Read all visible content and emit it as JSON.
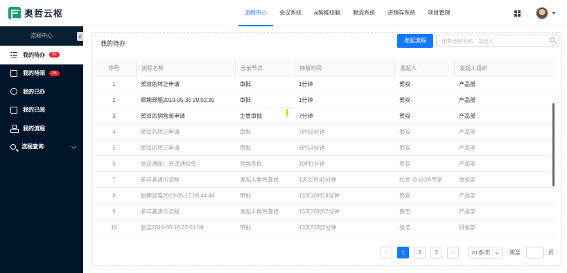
{
  "brand": {
    "name": "奥哲云枢"
  },
  "nav": [
    "流程中心",
    "会议系统",
    "ai智能纺聊",
    "物流系统",
    "进销存系统",
    "项目管理"
  ],
  "sidebar": {
    "title": "流程中心",
    "items": [
      {
        "label": "我的待办",
        "badge": "58"
      },
      {
        "label": "我的待阅",
        "badge": "35"
      },
      {
        "label": "我的已办"
      },
      {
        "label": "我的已阅"
      },
      {
        "label": "我的流程"
      },
      {
        "label": "流程查询"
      }
    ]
  },
  "main": {
    "title": "我的待办",
    "start_button": "发起流程",
    "search_placeholder": "搜索流程名称、发起人"
  },
  "table": {
    "columns": [
      "序号",
      "流程名称",
      "当前节点",
      "停留时间",
      "发起人",
      "发起人组织"
    ],
    "rows": [
      [
        "1",
        "贺双的转正申请",
        "审批",
        "1分钟",
        "贺双",
        "产品部"
      ],
      [
        "2",
        "佩鲍邸辊2019-05-30 20:02:20",
        "审批",
        "1分钟",
        "贺双",
        "产品部"
      ],
      [
        "3",
        "贺双的销售单申请",
        "主管审批",
        "7分钟",
        "贺双",
        "产品部"
      ],
      [
        "4",
        "贺双的转正申请",
        "审批",
        "7时55分钟",
        "贺双",
        "产品部"
      ],
      [
        "5",
        "贺双的转正申请",
        "审批",
        "8时14分钟",
        "贺双",
        "产品部"
      ],
      [
        "6",
        "会议通知：会议通知单",
        "领导签批",
        "10时1分钟",
        "贺双",
        "产品部"
      ],
      [
        "7",
        "参与者演示流程",
        "发起人角色查找",
        "1天20时41分钟",
        "纪龙-办公OA专家",
        "体验部"
      ],
      [
        "8",
        "佩鲍邸辊2019-05-17 09:44:44",
        "审批",
        "13天10时19分钟",
        "贺双",
        "产品部"
      ],
      [
        "9",
        "参与者演示流程",
        "发起人角色查找",
        "13天20时57分钟",
        "黄杰",
        "产品部"
      ],
      [
        "10",
        "张浩2019-05-16 22:01:09",
        "审批",
        "13天22时2分钟",
        "张浩",
        "研发部"
      ]
    ],
    "unread_rows": [
      0,
      1,
      2
    ]
  },
  "pagination": {
    "prev": "<",
    "pages": [
      "1",
      "2",
      "3"
    ],
    "current": "1",
    "next": ">",
    "page_size": "20 条/页",
    "jump_label": "跳至",
    "jump_unit": "页"
  },
  "colors": {
    "primary": "#1677ff",
    "sidebar_bg": "#001529",
    "badge": "#f5222d",
    "brand": "#14a36e"
  }
}
